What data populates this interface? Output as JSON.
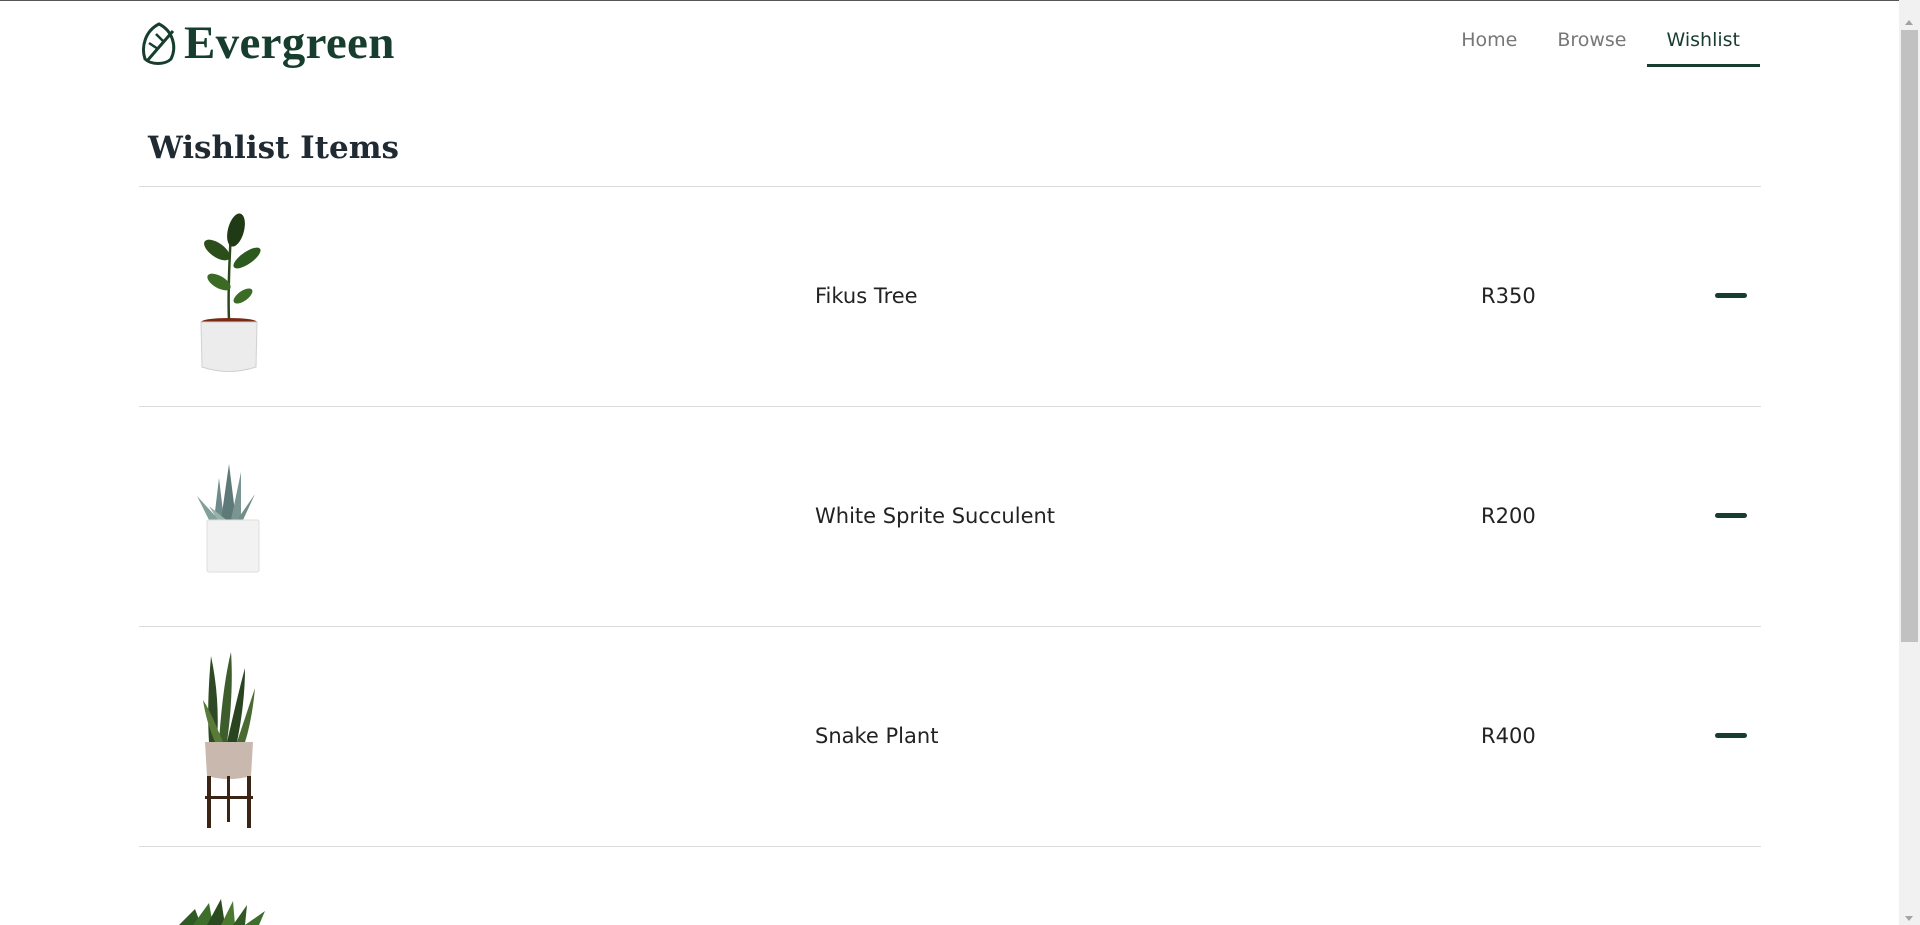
{
  "brand": {
    "name": "Evergreen",
    "color": "#173d2e",
    "icon": "leaf-icon"
  },
  "nav": {
    "items": [
      "Home",
      "Browse",
      "Wishlist"
    ],
    "active": "Wishlist"
  },
  "page": {
    "heading": "Wishlist Items"
  },
  "wishlist": {
    "items": [
      {
        "name": "Fikus Tree",
        "price": "R350",
        "image": "fikus-tree-image",
        "action_icon": "minus-icon"
      },
      {
        "name": "White Sprite Succulent",
        "price": "R200",
        "image": "succulent-image",
        "action_icon": "minus-icon"
      },
      {
        "name": "Snake Plant",
        "price": "R400",
        "image": "snake-plant-image",
        "action_icon": "minus-icon"
      }
    ]
  }
}
